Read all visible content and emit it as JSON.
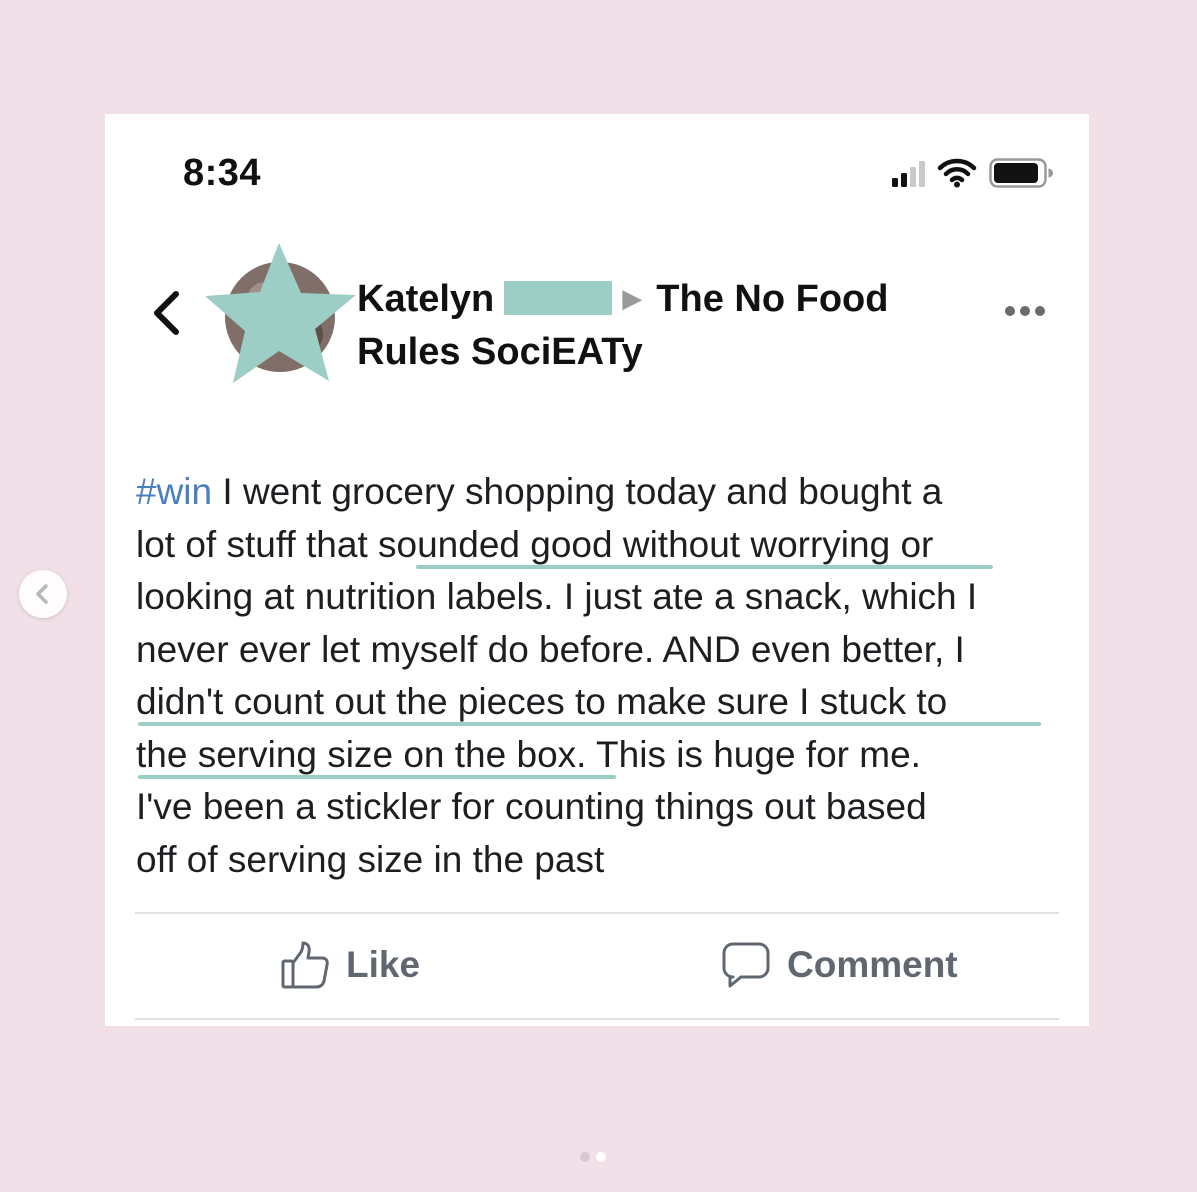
{
  "status_bar": {
    "time": "8:34",
    "signal_icon": "cellular-signal-icon",
    "wifi_icon": "wifi-icon",
    "battery_icon": "battery-icon"
  },
  "post_header": {
    "back_icon": "chevron-left-icon",
    "author_first_name": "Katelyn",
    "arrow_glyph": "▶",
    "group_name_line1": "The No Food",
    "group_name_line2": "Rules SociEATy",
    "more_icon": "more-options-icon"
  },
  "post_body": {
    "hashtag": "#win",
    "lines": [
      " I went grocery shopping today and bought a",
      "lot of stuff that sounded good without worrying or",
      "looking at nutrition labels. I just ate a snack, which I",
      "never ever let myself do before. AND even better, I",
      "didn't count out the pieces to make sure I stuck to",
      "the serving size on the box. This is huge for me.",
      "I've been a stickler for counting things out based",
      "off of serving size in the past"
    ]
  },
  "actions": {
    "like_label": "Like",
    "comment_label": "Comment"
  },
  "carousel": {
    "prev_icon": "carousel-prev-icon",
    "active_page": 2,
    "total_pages": 2
  },
  "colors": {
    "background": "#f1e0e8",
    "highlight": "#9ccec6",
    "hashtag": "#4a7fc1",
    "action_text": "#606770"
  }
}
